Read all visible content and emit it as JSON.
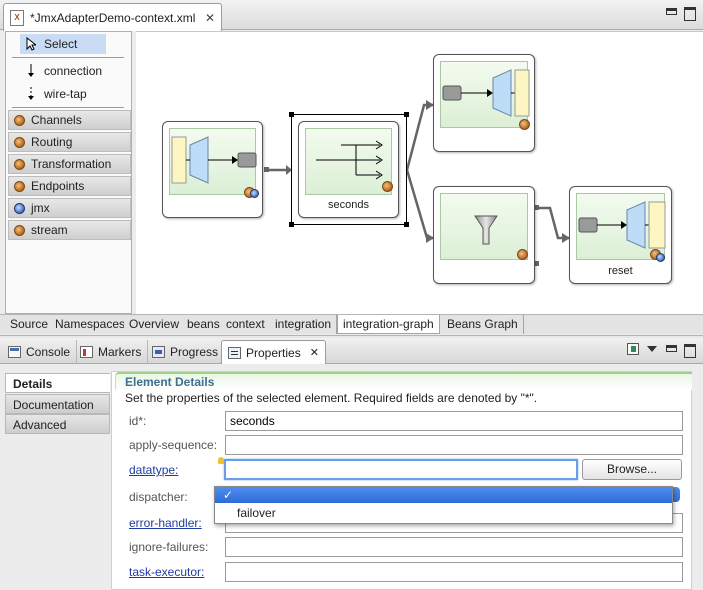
{
  "editor": {
    "tab_title": "*JmxAdapterDemo-context.xml",
    "palette": {
      "tools": [
        {
          "label": "Select"
        },
        {
          "label": "connection"
        },
        {
          "label": "wire-tap"
        }
      ],
      "drawers": [
        {
          "label": "Channels"
        },
        {
          "label": "Routing"
        },
        {
          "label": "Transformation"
        },
        {
          "label": "Endpoints"
        },
        {
          "label": "jmx"
        },
        {
          "label": "stream"
        }
      ]
    },
    "graph": {
      "nodes": [
        {
          "label": "seconds"
        },
        {
          "label": "reset"
        }
      ]
    },
    "bottom_tabs": [
      "Source",
      "Namespaces",
      "Overview",
      "beans",
      "context",
      "integration",
      "integration-graph",
      "Beans Graph"
    ],
    "active_bottom_tab": "integration-graph"
  },
  "views": {
    "tabs": [
      {
        "label": "Console",
        "icon": "console-icon"
      },
      {
        "label": "Markers",
        "icon": "markers-icon"
      },
      {
        "label": "Progress",
        "icon": "progress-icon"
      },
      {
        "label": "Properties",
        "icon": "properties-icon"
      }
    ],
    "properties": {
      "side_tabs": [
        "Details",
        "Documentation",
        "Advanced"
      ],
      "section_title": "Element Details",
      "section_desc": "Set the properties of the selected element. Required fields are denoted by \"*\".",
      "fields": [
        {
          "label": "id*:",
          "value": "seconds",
          "link": false
        },
        {
          "label": "apply-sequence:",
          "value": "",
          "link": false
        },
        {
          "label": "datatype:",
          "value": "",
          "link": true
        },
        {
          "label": "dispatcher:",
          "value": "",
          "link": false
        },
        {
          "label": "error-handler:",
          "value": "",
          "link": true
        },
        {
          "label": "ignore-failures:",
          "value": "",
          "link": false
        },
        {
          "label": "task-executor:",
          "value": "",
          "link": true
        }
      ],
      "browse_label": "Browse...",
      "dropdown": {
        "selected": "✓",
        "options": [
          "failover"
        ]
      }
    }
  }
}
